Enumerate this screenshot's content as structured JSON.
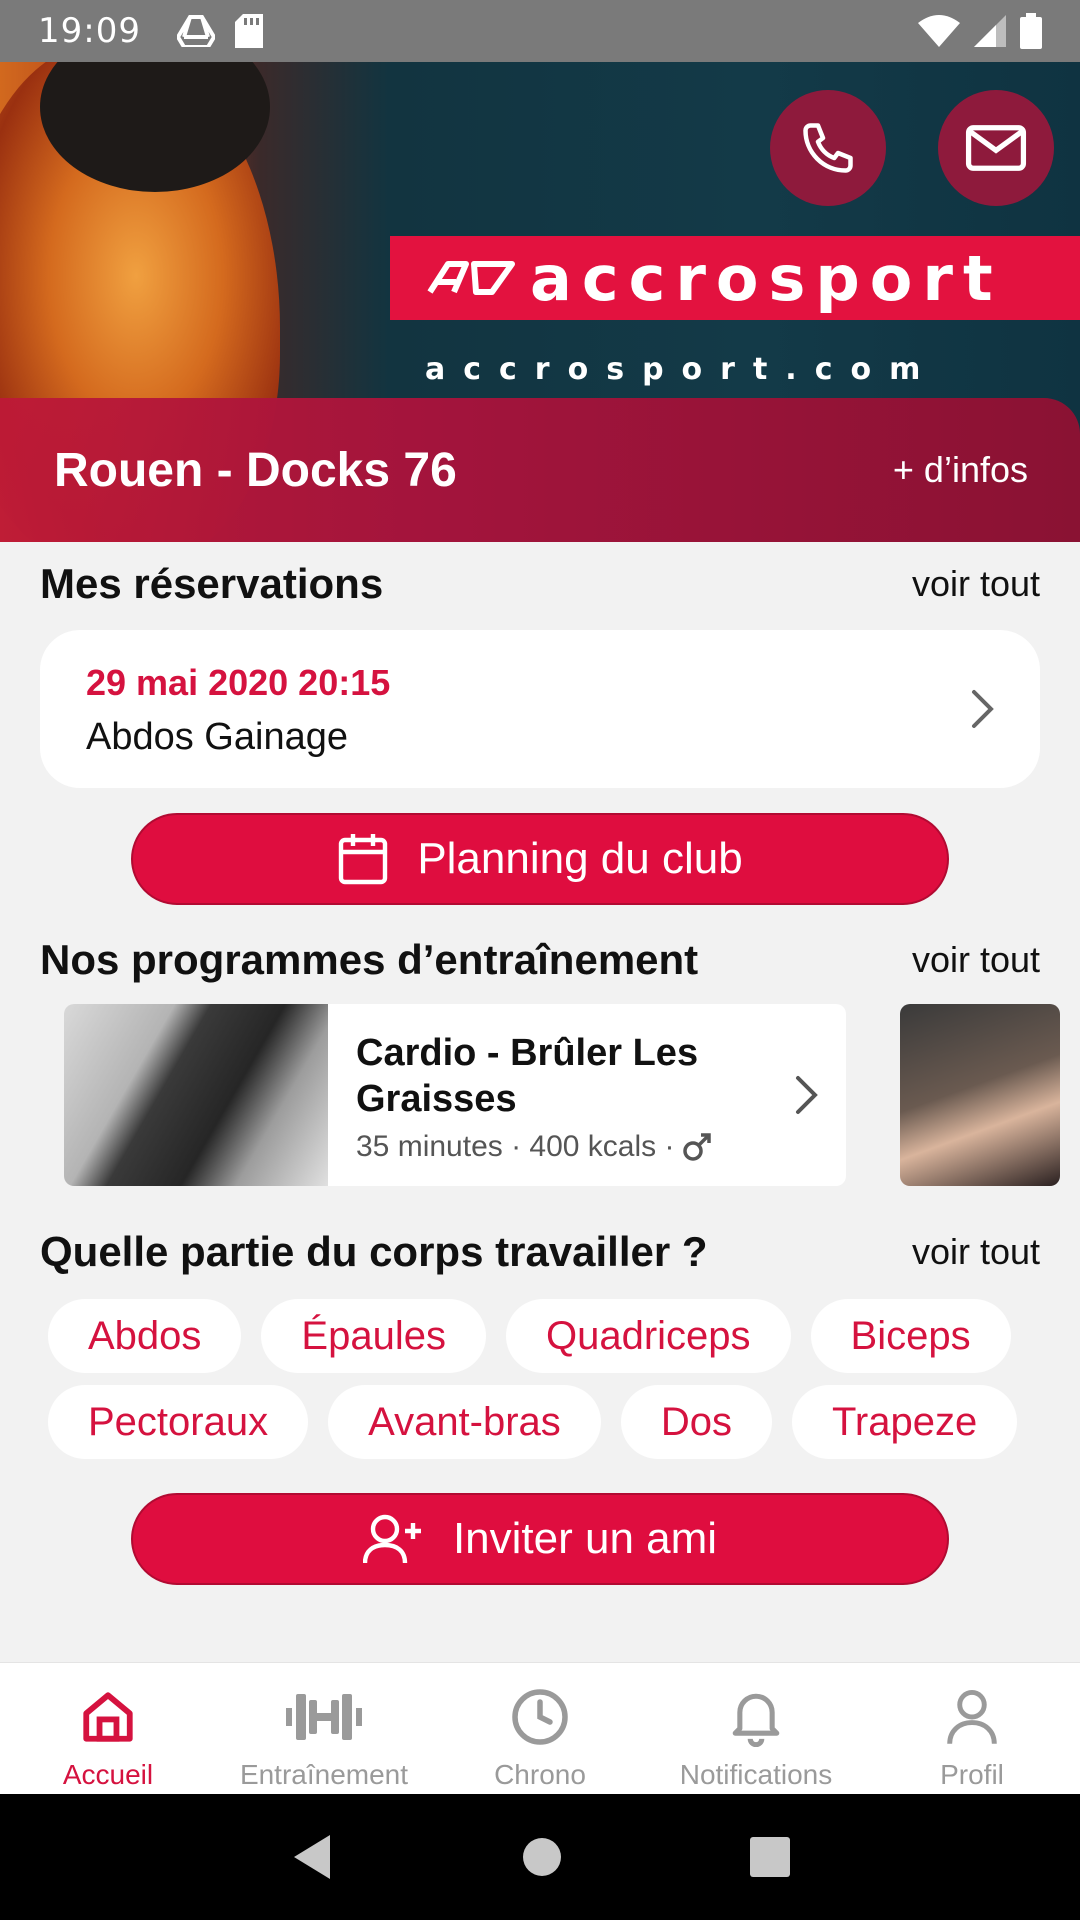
{
  "status_bar": {
    "time": "19:09",
    "left_icons": [
      "drive-icon",
      "sd-card-icon"
    ],
    "right_icons": [
      "wifi-icon",
      "signal-icon",
      "battery-icon"
    ]
  },
  "hero": {
    "brand_name": "accrosport",
    "brand_logo_text": "AD",
    "brand_url": "accrosport.com",
    "call_icon": "phone-icon",
    "mail_icon": "mail-icon",
    "club_name": "Rouen - Docks 76",
    "more_info": "+ d’infos"
  },
  "reservations": {
    "title": "Mes réservations",
    "see_all": "voir tout",
    "items": [
      {
        "date": "29 mai 2020 20:15",
        "name": "Abdos Gainage"
      }
    ]
  },
  "planning_button": {
    "label": "Planning du club",
    "icon": "calendar-icon"
  },
  "programs": {
    "title": "Nos programmes d’entraînement",
    "see_all": "voir tout",
    "items": [
      {
        "title": "Cardio - Brûler Les Graisses",
        "meta": "35 minutes · 400 kcals ·",
        "gender_icon": "male-icon"
      }
    ]
  },
  "body_parts": {
    "title": "Quelle partie du corps travailler ?",
    "see_all": "voir tout",
    "row1": [
      "Abdos",
      "Épaules",
      "Quadriceps",
      "Biceps"
    ],
    "row2": [
      "Pectoraux",
      "Avant-bras",
      "Dos",
      "Trapeze"
    ]
  },
  "invite_button": {
    "label": "Inviter un ami",
    "icon": "add-user-icon"
  },
  "bottom_nav": {
    "items": [
      {
        "label": "Accueil",
        "icon": "home-icon",
        "active": true
      },
      {
        "label": "Entraînement",
        "icon": "dumbbell-icon",
        "active": false
      },
      {
        "label": "Chrono",
        "icon": "clock-icon",
        "active": false
      },
      {
        "label": "Notifications",
        "icon": "bell-icon",
        "active": false
      },
      {
        "label": "Profil",
        "icon": "user-icon",
        "active": false
      }
    ]
  },
  "colors": {
    "accent": "#df0d3f",
    "accent_dark": "#8e1a3c",
    "background": "#f2f2f2",
    "inactive": "#9a9a9a"
  }
}
